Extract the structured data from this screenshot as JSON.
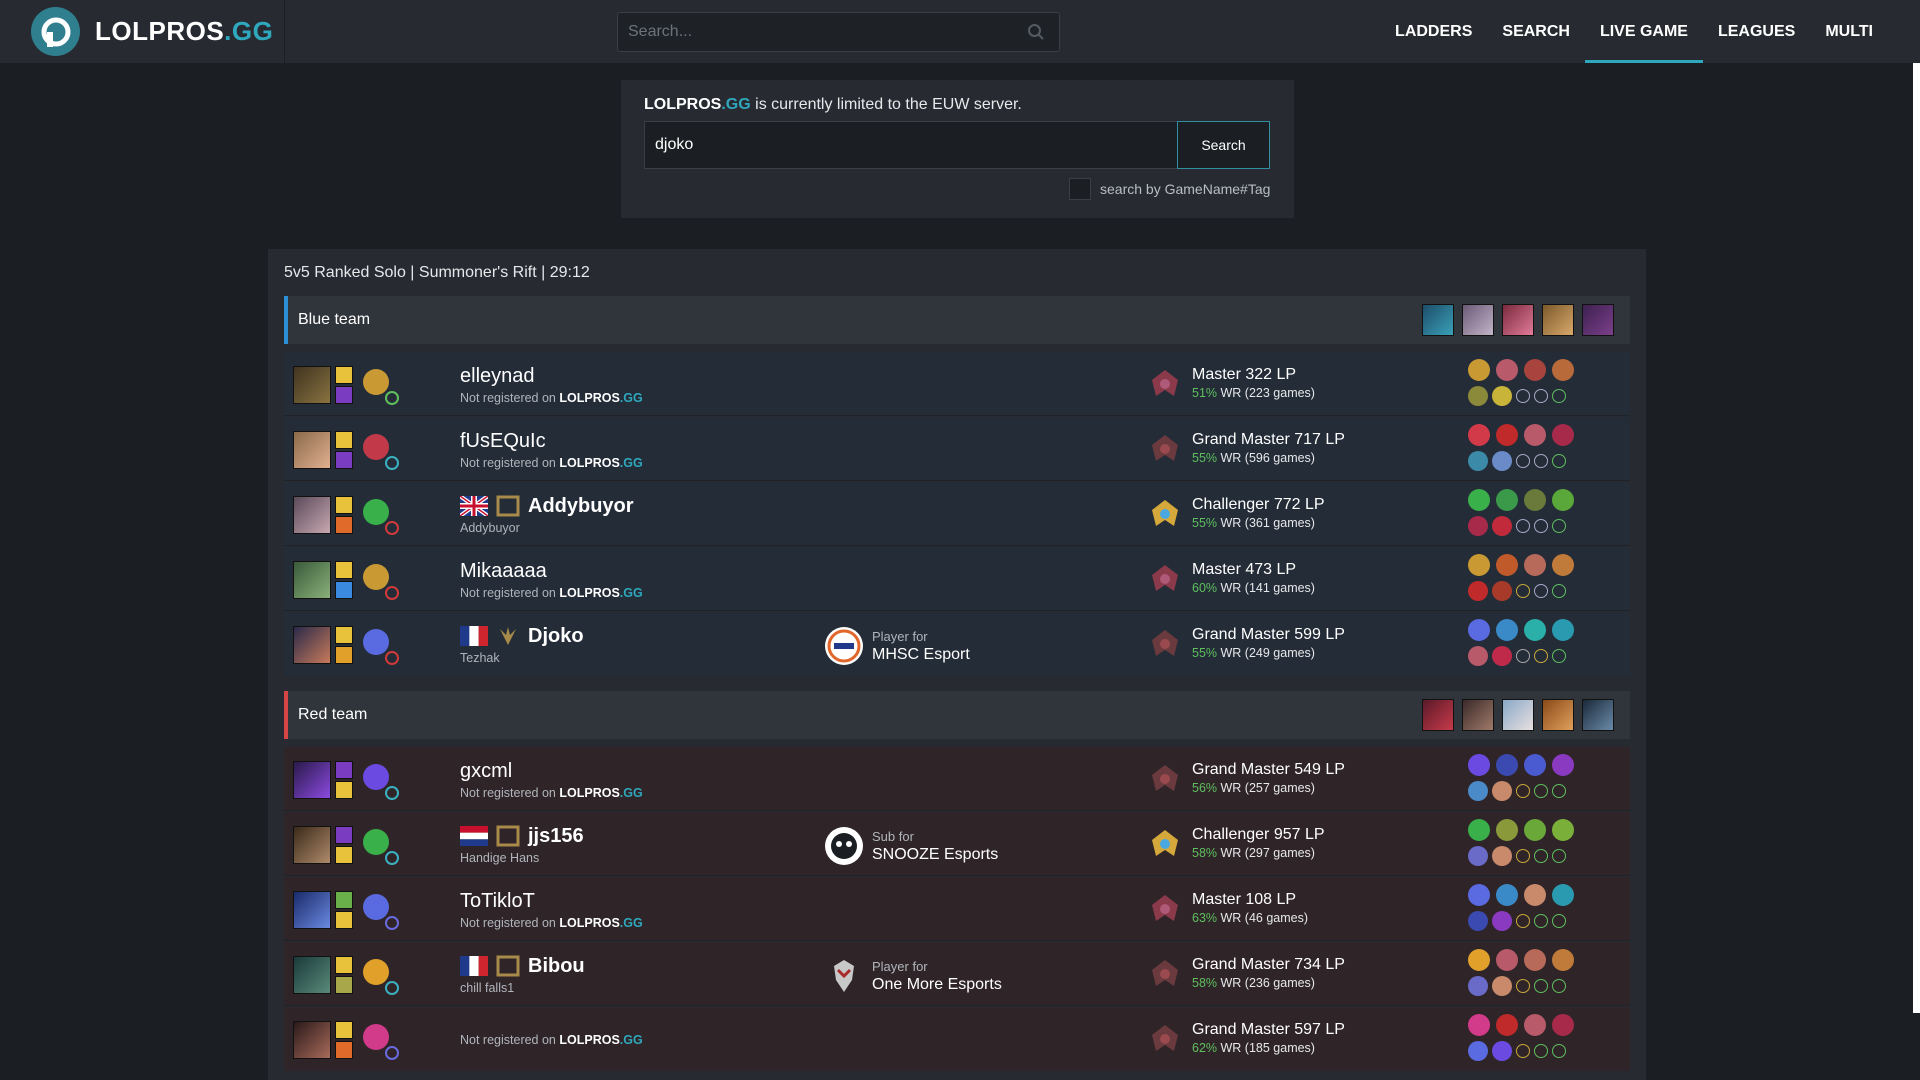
{
  "nav": {
    "logo_text": "LOLPROS",
    "logo_suffix": ".GG",
    "search_placeholder": "Search...",
    "items": [
      "LADDERS",
      "SEARCH",
      "LIVE GAME",
      "LEAGUES",
      "MULTI"
    ],
    "active": "LIVE GAME",
    "accent": "#2fa8bd"
  },
  "panel": {
    "brand": "LOLPROS",
    "brand_suffix": ".GG",
    "note": " is currently limited to the EUW server.",
    "input_value": "djoko",
    "button": "Search",
    "checkbox_label": "search by GameName#Tag"
  },
  "game": {
    "title": "5v5 Ranked Solo | Summoner's Rift | 29:12",
    "blue_team": {
      "label": "Blue team",
      "color": "#2d8fd6",
      "players": [
        {
          "name": "elleynad",
          "sub": "Not registered on ",
          "sub_brand": "LOLPROS",
          "sub_suffix": ".GG",
          "tier": "Master 322 LP",
          "wr_pct": "51%",
          "wr_rest": " WR (223 games)"
        },
        {
          "name": "fUsEQuIc",
          "sub": "Not registered on ",
          "sub_brand": "LOLPROS",
          "sub_suffix": ".GG",
          "tier": "Grand Master 717 LP",
          "wr_pct": "55%",
          "wr_rest": " WR (596 games)"
        },
        {
          "name": "Addybuyor",
          "sub": "Addybuyor",
          "tier": "Challenger 772 LP",
          "wr_pct": "55%",
          "wr_rest": " WR (361 games)"
        },
        {
          "name": "Mikaaaaa",
          "sub": "Not registered on ",
          "sub_brand": "LOLPROS",
          "sub_suffix": ".GG",
          "tier": "Master 473 LP",
          "wr_pct": "60%",
          "wr_rest": " WR (141 games)"
        },
        {
          "name": "Djoko",
          "sub": "Tezhak",
          "team_role": "Player for",
          "team_name": "MHSC Esport",
          "tier": "Grand Master 599 LP",
          "wr_pct": "55%",
          "wr_rest": " WR (249 games)"
        }
      ]
    },
    "red_team": {
      "label": "Red team",
      "color": "#d64545",
      "players": [
        {
          "name": "gxcml",
          "sub": "Not registered on ",
          "sub_brand": "LOLPROS",
          "sub_suffix": ".GG",
          "tier": "Grand Master 549 LP",
          "wr_pct": "56%",
          "wr_rest": " WR (257 games)"
        },
        {
          "name": "jjs156",
          "sub": "Handige Hans",
          "team_role": "Sub for",
          "team_name": "SNOOZE Esports",
          "tier": "Challenger 957 LP",
          "wr_pct": "58%",
          "wr_rest": " WR (297 games)"
        },
        {
          "name": "ToTikloT",
          "sub": "Not registered on ",
          "sub_brand": "LOLPROS",
          "sub_suffix": ".GG",
          "tier": "Master 108 LP",
          "wr_pct": "63%",
          "wr_rest": " WR (46 games)"
        },
        {
          "name": "Bibou",
          "sub": "chill falls1",
          "team_role": "Player for",
          "team_name": "One More Esports",
          "tier": "Grand Master 734 LP",
          "wr_pct": "58%",
          "wr_rest": " WR (236 games)"
        },
        {
          "name": "",
          "sub": "Not registered on ",
          "sub_brand": "LOLPROS",
          "sub_suffix": ".GG",
          "tier": "Grand Master 597 LP",
          "wr_pct": "62%",
          "wr_rest": " WR (185 games)"
        }
      ]
    }
  }
}
